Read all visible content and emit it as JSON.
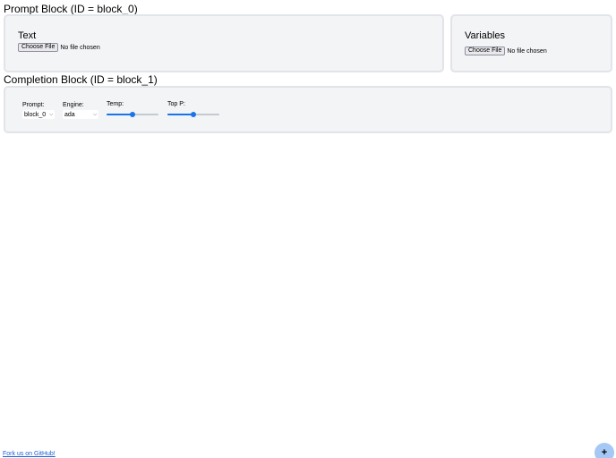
{
  "prompt_block": {
    "title": "Prompt Block (ID = block_0)",
    "text_panel": {
      "heading": "Text",
      "file_button": "Choose File",
      "file_status": "No file chosen"
    },
    "variables_panel": {
      "heading": "Variables",
      "file_button": "Choose File",
      "file_status": "No file chosen"
    }
  },
  "completion_block": {
    "title": "Completion Block (ID = block_1)",
    "prompt": {
      "label": "Prompt:",
      "value": "block_0"
    },
    "engine": {
      "label": "Engine:",
      "value": "ada"
    },
    "temp": {
      "label": "Temp:",
      "value": 0.5
    },
    "top_p": {
      "label": "Top P:",
      "value": 0.5
    }
  },
  "footer": {
    "github_link": "Fork us on GitHub!",
    "add_button": "+"
  },
  "colors": {
    "accent": "#1a73e8",
    "card_bg": "#f2f4f6",
    "card_border": "#e1e4e8",
    "fab_bg": "#a5c8f5",
    "link": "#1a5fd6"
  }
}
